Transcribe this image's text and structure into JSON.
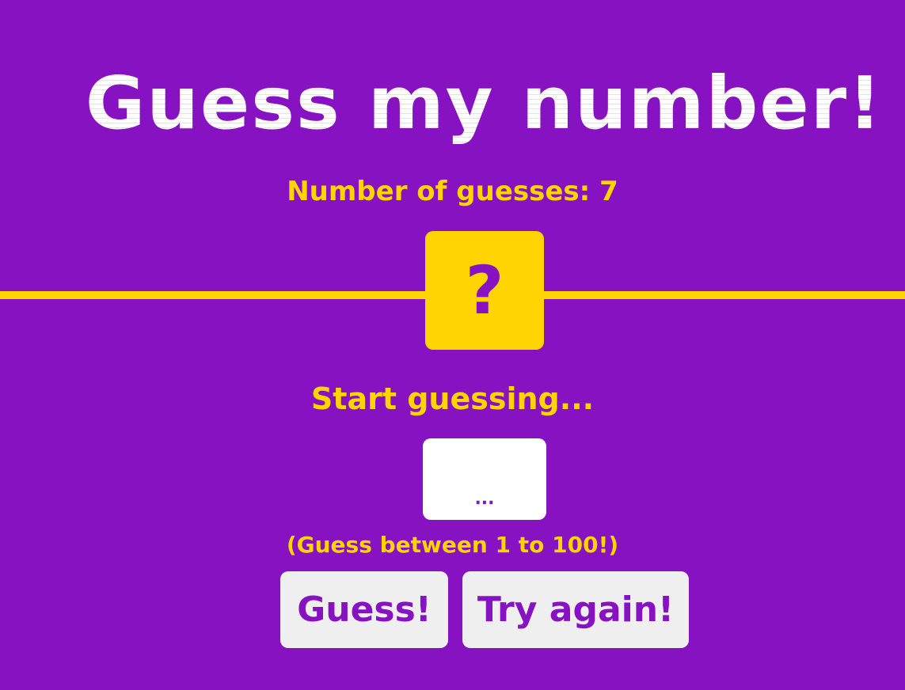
{
  "title": "Guess my number!",
  "guess_counter": "Number of guesses: 7",
  "secret_number": {
    "display": "?"
  },
  "status_message": "Start guessing...",
  "guess_input": {
    "value": "",
    "placeholder": "..."
  },
  "range_hint": "(Guess between 1 to 100!)",
  "buttons": {
    "guess_label": "Guess!",
    "try_again_label": "Try again!"
  },
  "colors": {
    "background": "#8712c1",
    "accent": "#ffd400",
    "title_text": "#ffffff",
    "button_background": "#f0eff0"
  }
}
